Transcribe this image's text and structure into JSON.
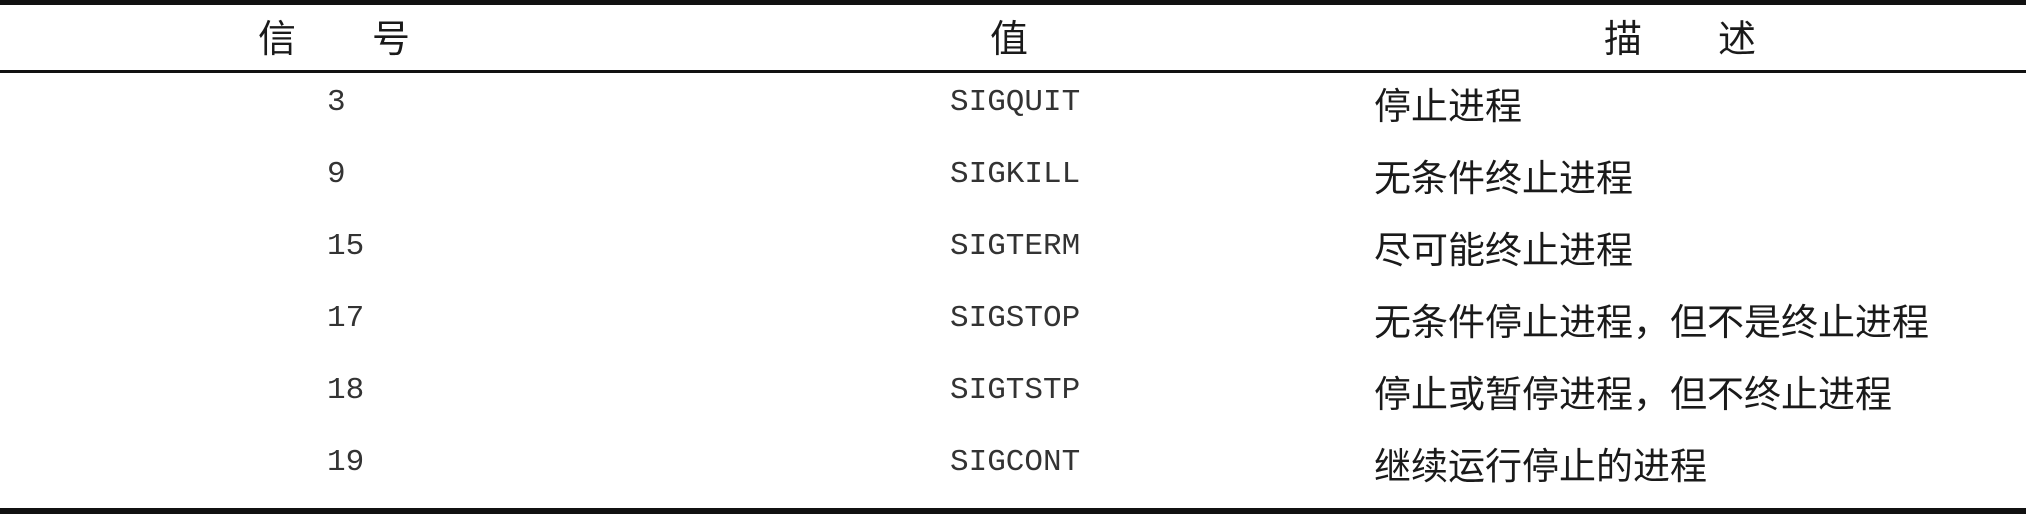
{
  "table": {
    "headers": {
      "signal": "信　　号",
      "value": "值",
      "description": "描　　述"
    },
    "rows": [
      {
        "signal": "3",
        "value": "SIGQUIT",
        "description": "停止进程"
      },
      {
        "signal": "9",
        "value": "SIGKILL",
        "description": "无条件终止进程"
      },
      {
        "signal": "15",
        "value": "SIGTERM",
        "description": "尽可能终止进程"
      },
      {
        "signal": "17",
        "value": "SIGSTOP",
        "description": "无条件停止进程，但不是终止进程"
      },
      {
        "signal": "18",
        "value": "SIGTSTP",
        "description": "停止或暂停进程，但不终止进程"
      },
      {
        "signal": "19",
        "value": "SIGCONT",
        "description": "继续运行停止的进程"
      }
    ]
  }
}
